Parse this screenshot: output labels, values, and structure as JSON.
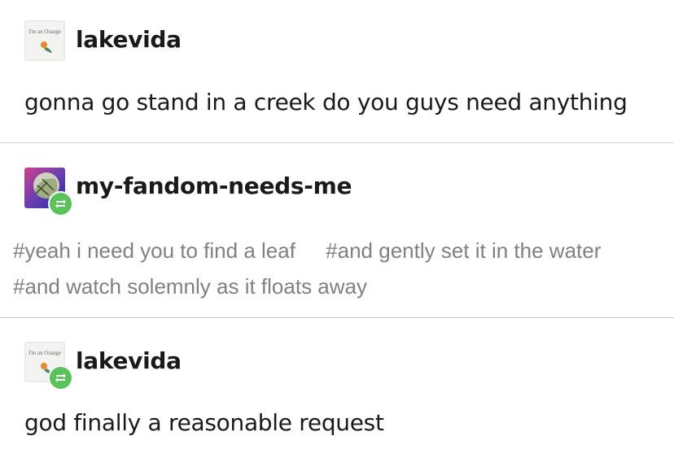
{
  "posts": [
    {
      "username": "lakevida",
      "avatar_icon": "orange-sticky-note-avatar",
      "avatar_caption": "I'm an Orange",
      "reblogged": false,
      "text": "gonna go stand in a creek do you guys need anything"
    },
    {
      "username": "my-fandom-needs-me",
      "avatar_icon": "blue-purple-photo-avatar",
      "reblogged": true,
      "tags": [
        "#yeah i need you to find a leaf",
        "#and gently set it in the water",
        "#and watch solemnly as it floats away"
      ]
    },
    {
      "username": "lakevida",
      "avatar_icon": "orange-sticky-note-avatar",
      "avatar_caption": "I'm an Orange",
      "reblogged": true,
      "text": "god finally a reasonable request"
    }
  ],
  "colors": {
    "divider": "#cfcfcf",
    "reblog_badge": "#5ac25a",
    "tag_text": "#808080"
  },
  "icons": {
    "reblog": "reblog-icon"
  }
}
